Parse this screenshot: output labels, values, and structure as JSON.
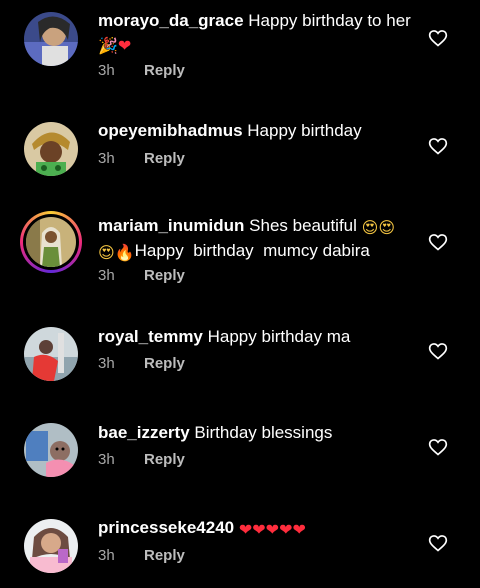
{
  "colors": {
    "background": "#000000",
    "text": "#ffffff",
    "muted": "#a8a8a8",
    "heart_emoji": "#ff2d3d"
  },
  "comments": [
    {
      "username": "morayo_da_grace",
      "text": "Happy birthday to her",
      "emojis_after": [
        "party-popper",
        "red-heart"
      ],
      "time": "3h",
      "reply": "Reply",
      "like_icon": "heart-outline-icon"
    },
    {
      "username": "opeyemibhadmus",
      "text": "Happy birthday",
      "time": "3h",
      "reply": "Reply",
      "like_icon": "heart-outline-icon"
    },
    {
      "username": "mariam_inumidun",
      "text_before": "Shes beautiful",
      "text_after": "Happy  birthday  mumcy dabira",
      "emojis_inline": [
        "heart-eyes",
        "heart-eyes",
        "heart-eyes",
        "fire"
      ],
      "time": "3h",
      "reply": "Reply",
      "like_icon": "heart-outline-icon",
      "has_story_ring": true
    },
    {
      "username": "royal_temmy",
      "text": "Happy birthday ma",
      "time": "3h",
      "reply": "Reply",
      "like_icon": "heart-outline-icon"
    },
    {
      "username": "bae_izzerty",
      "text": "Birthday blessings",
      "time": "3h",
      "reply": "Reply",
      "like_icon": "heart-outline-icon"
    },
    {
      "username": "princesseke4240",
      "text": "",
      "emojis_after": [
        "red-heart",
        "red-heart",
        "red-heart",
        "red-heart",
        "red-heart"
      ],
      "time": "3h",
      "reply": "Reply",
      "like_icon": "heart-outline-icon"
    }
  ]
}
